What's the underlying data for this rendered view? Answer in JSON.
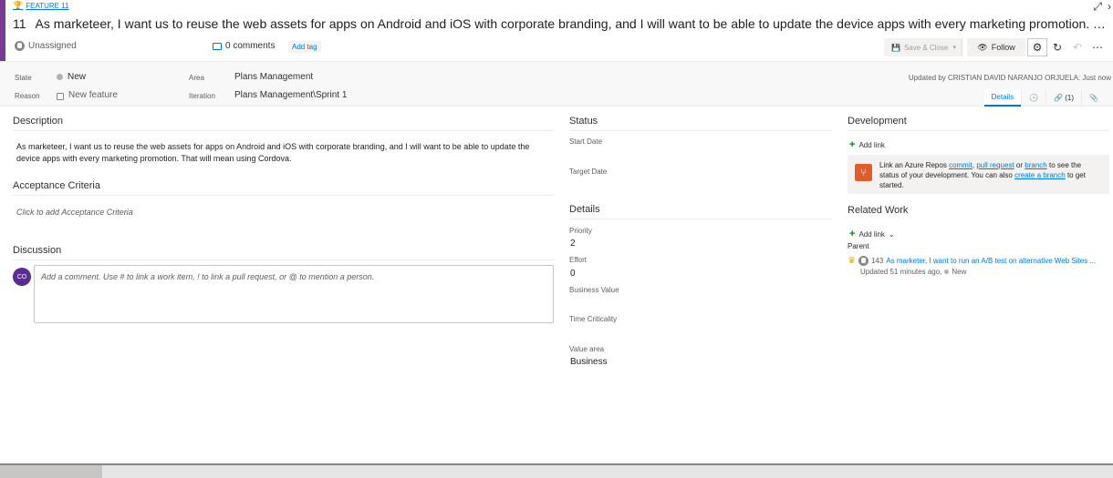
{
  "header": {
    "feature_link": "FEATURE 11",
    "work_item_id": "11",
    "title": "As marketeer, I want us to reuse the web assets for apps on Android and iOS with corporate branding, and I will want to be able to update the device apps with every marketing promotion. That will me...",
    "assigned_to": "Unassigned",
    "comments_label": "0 comments",
    "add_tag_label": "Add tag",
    "save_close_label": "Save & Close",
    "follow_label": "Follow"
  },
  "fields": {
    "state_label": "State",
    "state_value": "New",
    "reason_label": "Reason",
    "reason_value": "New feature",
    "area_label": "Area",
    "area_value": "Plans Management",
    "iteration_label": "Iteration",
    "iteration_value": "Plans Management\\Sprint 1",
    "updated_text": "Updated by CRISTIAN DAVID NARANJO ORJUELA: Just now"
  },
  "page_tabs": {
    "details": "Details",
    "links": "(1)"
  },
  "description": {
    "title": "Description",
    "text": "As marketeer, I want us to reuse the web assets for apps on Android and iOS with corporate branding, and I will want to be able to update the device apps with every marketing promotion. That will mean using Cordova."
  },
  "acceptance": {
    "title": "Acceptance Criteria",
    "placeholder": "Click to add Acceptance Criteria"
  },
  "discussion": {
    "title": "Discussion",
    "avatar_initials": "CO",
    "placeholder": "Add a comment. Use # to link a work item, ! to link a pull request, or @ to mention a person."
  },
  "status": {
    "title": "Status",
    "start_date_label": "Start Date",
    "target_date_label": "Target Date"
  },
  "details": {
    "title": "Details",
    "priority_label": "Priority",
    "priority_value": "2",
    "effort_label": "Effort",
    "effort_value": "0",
    "business_value_label": "Business Value",
    "time_criticality_label": "Time Criticality",
    "value_area_label": "Value area",
    "value_area_value": "Business"
  },
  "development": {
    "title": "Development",
    "add_link": "Add link",
    "text_1": "Link an Azure Repos",
    "link_commit": "commit",
    "text_2": ",",
    "link_pull_request": "pull request",
    "text_3": "or",
    "link_branch": "branch",
    "text_4": "to see the status of your development. You can also",
    "link_create_branch": "create a branch",
    "text_5": "to get started."
  },
  "related_work": {
    "title": "Related Work",
    "add_link": "Add link",
    "parent_label": "Parent",
    "parent_id": "143",
    "parent_title": "As marketer, I want to run an A/B test on alternative Web Sites ...",
    "parent_updated": "Updated 51 minutes ago,",
    "parent_state": "New"
  },
  "colors": {
    "accent": "#773b93",
    "link": "#0078d4",
    "avatar": "#5c2d91",
    "dev_icon": "#e05c2a"
  }
}
